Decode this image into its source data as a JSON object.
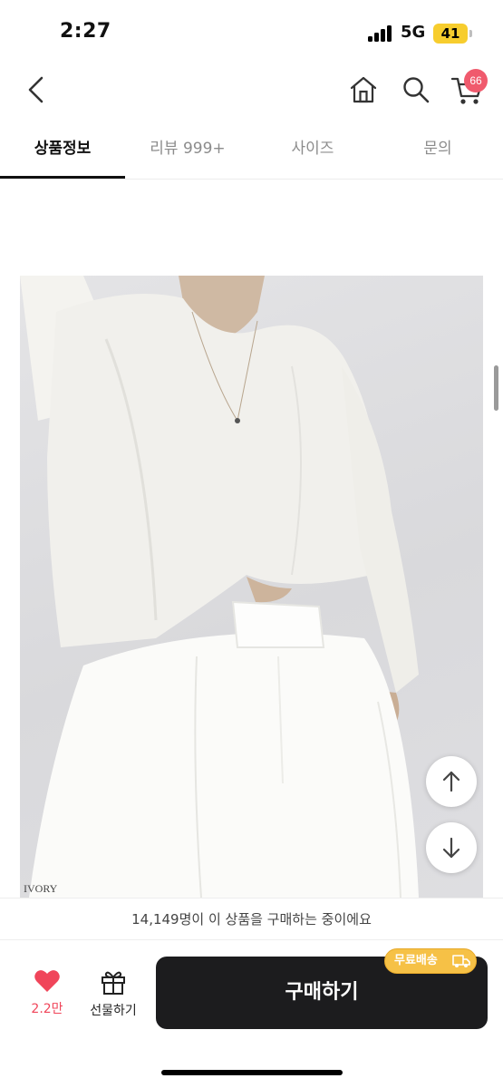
{
  "status": {
    "time": "2:27",
    "network": "5G",
    "battery": "41"
  },
  "nav": {
    "back_icon": "chevron-left-icon",
    "home_icon": "home-icon",
    "search_icon": "search-icon",
    "cart_icon": "cart-icon",
    "cart_count": "66"
  },
  "tabs": [
    {
      "label": "상품정보",
      "active": true
    },
    {
      "label": "리뷰 999+",
      "active": false
    },
    {
      "label": "사이즈",
      "active": false
    },
    {
      "label": "문의",
      "active": false
    }
  ],
  "product": {
    "color_label": "IVORY"
  },
  "scroll_buttons": {
    "up_icon": "arrow-up-icon",
    "down_icon": "arrow-down-icon"
  },
  "notice": {
    "buying_text": "14,149명이 이 상품을 구매하는 중이에요"
  },
  "actions": {
    "like_count": "2.2만",
    "gift_label": "선물하기",
    "buy_label": "구매하기",
    "free_shipping_label": "무료배송"
  },
  "colors": {
    "accent_red": "#f0455a",
    "badge": "#f05a6d",
    "buy_button": "#1c1c1e",
    "free_shipping": "#f6c146"
  }
}
